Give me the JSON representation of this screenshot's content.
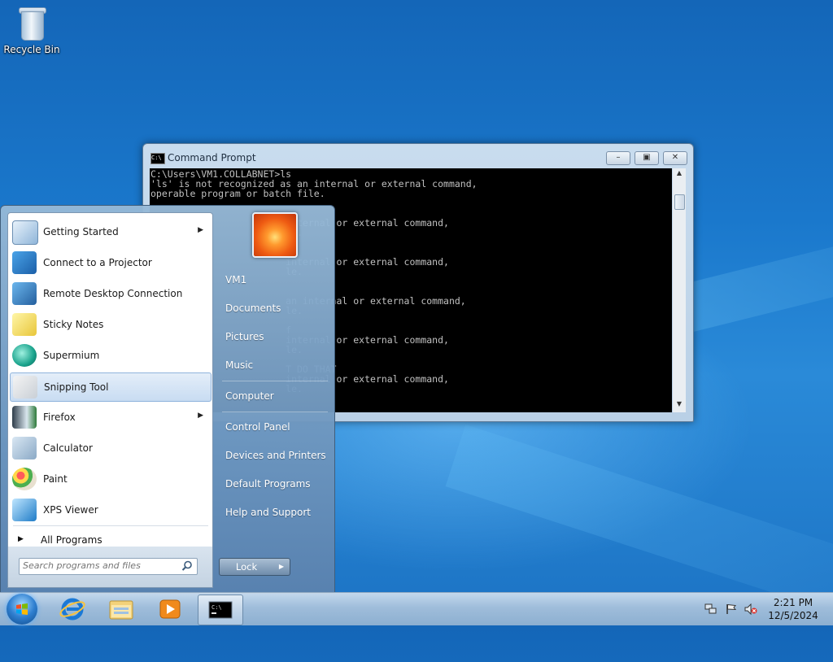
{
  "desktop": {
    "icons": [
      {
        "label": "Recycle Bin",
        "icon": "recycle-bin-icon"
      }
    ]
  },
  "cmd_window": {
    "title": "Command Prompt",
    "controls": {
      "minimize": "minimize",
      "maximize": "maximize",
      "close": "close"
    },
    "console_text": "C:\\Users\\VM1.COLLABNET>ls\n'ls' is not recognized as an internal or external command,\noperable program or batch file.\n\n\n                        internal or external command,\n                        le.\n\n\n                        internal or external command,\n                        le.\n\n\n                        an internal or external command,\n                        le.\n\n                        f\n                        internal or external command,\n                        le.\n\n                        T DO THAT\n                        internal or external command,\n                        le."
  },
  "start_menu": {
    "programs": [
      {
        "label": "Getting Started",
        "icon": "getting-started-icon",
        "submenu": true
      },
      {
        "label": "Connect to a Projector",
        "icon": "projector-icon",
        "submenu": false
      },
      {
        "label": "Remote Desktop Connection",
        "icon": "remote-desktop-icon",
        "submenu": false
      },
      {
        "label": "Sticky Notes",
        "icon": "sticky-notes-icon",
        "submenu": false
      },
      {
        "label": "Supermium",
        "icon": "supermium-icon",
        "submenu": false
      },
      {
        "label": "Snipping Tool",
        "icon": "snipping-tool-icon",
        "submenu": false,
        "highlighted": true
      },
      {
        "label": "Firefox",
        "icon": "firefox-icon",
        "submenu": true
      },
      {
        "label": "Calculator",
        "icon": "calculator-icon",
        "submenu": false
      },
      {
        "label": "Paint",
        "icon": "paint-icon",
        "submenu": false
      },
      {
        "label": "XPS Viewer",
        "icon": "xps-viewer-icon",
        "submenu": false
      }
    ],
    "all_programs": "All Programs",
    "search_placeholder": "Search programs and files",
    "right_links": {
      "user": "VM1",
      "documents": "Documents",
      "pictures": "Pictures",
      "music": "Music",
      "computer": "Computer",
      "control_panel": "Control Panel",
      "devices_printers": "Devices and Printers",
      "default_programs": "Default Programs",
      "help_support": "Help and Support"
    },
    "shutdown_label": "Lock"
  },
  "taskbar": {
    "pinned": [
      "start-orb",
      "internet-explorer-icon",
      "file-explorer-icon",
      "media-player-icon",
      "command-prompt-icon"
    ],
    "clock": {
      "time": "2:21 PM",
      "date": "12/5/2024"
    }
  },
  "colors": {
    "desktop_blue": "#1a78cc",
    "console_bg": "#000000",
    "console_fg": "#c0c0c0",
    "highlight": "#c8dcf2"
  }
}
